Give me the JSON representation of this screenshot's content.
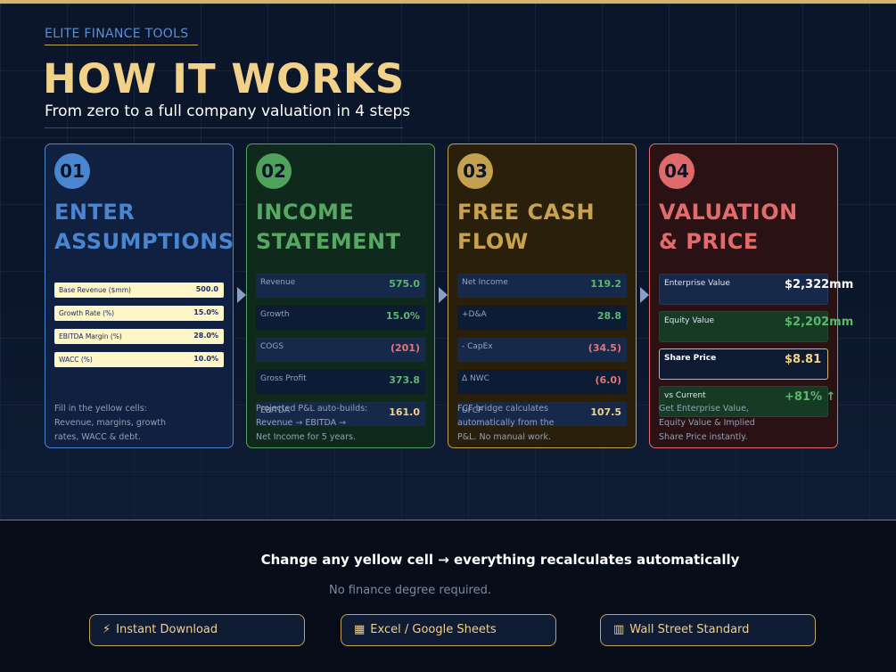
{
  "header": {
    "eyebrow": "ELITE FINANCE TOOLS",
    "title": "HOW IT WORKS",
    "subtitle": "From zero to a full company valuation in 4 steps"
  },
  "steps": [
    {
      "number": "01",
      "title_line1": "ENTER",
      "title_line2": "ASSUMPTIONS",
      "inputs": [
        {
          "label": "Base Revenue ($mm)",
          "value": "500.0"
        },
        {
          "label": "Growth Rate (%)",
          "value": "15.0%"
        },
        {
          "label": "EBITDA Margin (%)",
          "value": "28.0%"
        },
        {
          "label": "WACC (%)",
          "value": "10.0%"
        }
      ],
      "desc_lines": [
        "Fill in the yellow cells:",
        "Revenue, margins, growth",
        "rates, WACC & debt."
      ]
    },
    {
      "number": "02",
      "title_line1": "INCOME",
      "title_line2": "STATEMENT",
      "rows": [
        {
          "label": "Revenue",
          "value": "575.0"
        },
        {
          "label": "Growth",
          "value": "15.0%"
        },
        {
          "label": "COGS",
          "value": "(201)"
        },
        {
          "label": "Gross Profit",
          "value": "373.8"
        },
        {
          "label": "EBITDA",
          "value": "161.0"
        }
      ],
      "desc_lines": [
        "Projected P&L auto-builds:",
        "Revenue → EBITDA →",
        "Net Income for 5 years."
      ]
    },
    {
      "number": "03",
      "title_line1": "FREE CASH",
      "title_line2": "FLOW",
      "rows": [
        {
          "label": "Net Income",
          "value": "119.2"
        },
        {
          "label": "+D&A",
          "value": "28.8"
        },
        {
          "label": "- CapEx",
          "value": "(34.5)"
        },
        {
          "label": "Δ NWC",
          "value": "(6.0)"
        },
        {
          "label": "UFCF",
          "value": "107.5"
        }
      ],
      "desc_lines": [
        "FCF bridge calculates",
        "automatically from the",
        "P&L. No manual work."
      ]
    },
    {
      "number": "04",
      "title_line1": "VALUATION",
      "title_line2": "& PRICE",
      "rows": [
        {
          "label": "Enterprise Value",
          "value": "$2,322mm"
        },
        {
          "label": "Equity Value",
          "value": "$2,202mm"
        },
        {
          "label": "Share Price",
          "value": "$8.81"
        },
        {
          "label": "vs Current",
          "value": "+81% ↑"
        }
      ],
      "desc_lines": [
        "Get Enterprise Value,",
        "Equity Value & Implied",
        "Share Price instantly."
      ]
    }
  ],
  "footer": {
    "headline": "Change any yellow cell → everything recalculates automatically",
    "subline": "No finance degree required.",
    "pills": [
      {
        "icon": "⚡",
        "label": "Instant Download"
      },
      {
        "icon": "▦",
        "label": "Excel / Google Sheets"
      },
      {
        "icon": "▥",
        "label": "Wall Street Standard"
      }
    ]
  },
  "colors": {
    "gold": "#f2d188",
    "blue": "#4a86d0",
    "green": "#4fa25c",
    "amber": "#c5a04e",
    "red": "#e06a6a",
    "background": "#0b1527"
  }
}
